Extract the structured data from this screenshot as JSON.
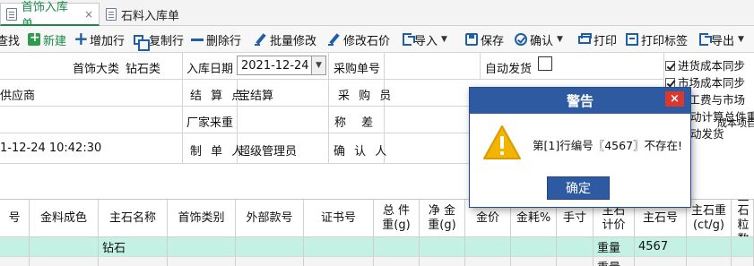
{
  "tabs": [
    {
      "label": "首饰入库单",
      "active": true
    },
    {
      "label": "石料入库单",
      "active": false
    }
  ],
  "tab_close_glyph": "×",
  "toolbar": {
    "search_label": "查找",
    "new_label": "新建",
    "add_row_label": "增加行",
    "copy_row_label": "复制行",
    "delete_row_label": "删除行",
    "batch_edit_label": "批量修改",
    "edit_stone_price_label": "修改石价",
    "import_label": "导入",
    "save_label": "保存",
    "confirm_label": "确认",
    "print_label": "打印",
    "print_tag_label": "打印标签",
    "export_label": "导出"
  },
  "form": {
    "jewelry_category_label": "首饰大类",
    "jewelry_category_value": "钻石类",
    "stock_in_date_label": "入库日期",
    "stock_in_date_value": "2021-12-24",
    "purchase_no_label": "采购单号",
    "auto_ship_label": "自动发货",
    "supplier_value": "供应商",
    "settlement_point_label": "结 算 点",
    "settlement_point_value": "宝结算",
    "purchaser_label": "采 购 员",
    "vendor_weight_label": "厂家来重",
    "weigh_diff_label": "称　 差",
    "created_time_value": "1-12-24 10:42:30",
    "creator_label": "制 单 人",
    "creator_value": "超级管理员",
    "confirmer_label": "确 认 人"
  },
  "right_panel": {
    "options": [
      {
        "label": "进货成本同步",
        "checked": true
      },
      {
        "label": "市场成本同步",
        "checked": true
      },
      {
        "label": "售工费与市场",
        "checked": false
      },
      {
        "label": "动计算总件重",
        "checked": false
      },
      {
        "label": "动发货",
        "checked": false
      }
    ],
    "cost_project_label": "成本项目"
  },
  "grid": {
    "columns": [
      "号",
      "金料成色",
      "主石名称",
      "首饰类别",
      "外部款号",
      "证书号",
      "总 件\n重(g)",
      "净 金\n重(g)",
      "金价",
      "金耗%",
      "手寸",
      "主石\n计价",
      "主石号",
      "主石重\n(ct/g)",
      "主石\n粒数"
    ],
    "rows": [
      [
        "",
        "",
        "钻石",
        "",
        "",
        "",
        "",
        "",
        "",
        "",
        "",
        "重量",
        "4567",
        "",
        ""
      ],
      [
        "",
        "",
        "",
        "",
        "",
        "",
        "",
        "",
        "",
        "",
        "",
        "重量",
        "",
        "",
        ""
      ]
    ]
  },
  "dialog": {
    "title": "警告",
    "close_glyph": "×",
    "message": "第[1]行编号〖4567〗不存在!",
    "ok_label": "确定"
  },
  "colors": {
    "accent_green": "#1b8a4b",
    "toolbar_icon_blue": "#1f5fa8",
    "dialog_blue": "#2d5aa0",
    "close_red": "#d9382e",
    "warning_yellow": "#f2b400",
    "selected_row": "#c5f0e4"
  }
}
